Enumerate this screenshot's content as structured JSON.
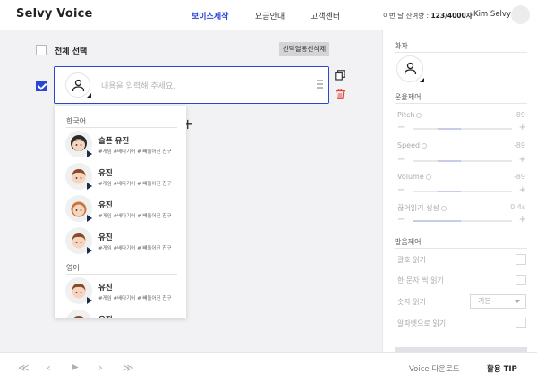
{
  "header": {
    "logo": "Selvy Voice",
    "nav": [
      "보이스제작",
      "요금안내",
      "고객센터"
    ],
    "usage_prefix": "이번 달 잔여량 : ",
    "usage_value": "123/4000자",
    "username": "Kim Selvy"
  },
  "editor": {
    "select_all_label": "전체 선택",
    "delete_selected": "선택열동선삭제",
    "placeholder": "내용을 입력해 주세요.",
    "add_symbol": "+"
  },
  "voice_dropdown": {
    "groups": [
      {
        "label": "한국어",
        "voices": [
          {
            "name": "슬픈 유진",
            "tags": "#게임 #배다기어 # 빼돌어진 친구"
          },
          {
            "name": "유진",
            "tags": "#게임 #배다기어 # 빼돌어진 친구"
          },
          {
            "name": "유진",
            "tags": "#게임 #배다기어 # 빼돌어진 친구"
          },
          {
            "name": "유진",
            "tags": "#게임 #배다기어 # 빼돌어진 친구"
          }
        ]
      },
      {
        "label": "영어",
        "voices": [
          {
            "name": "유진",
            "tags": "#게임 #배다기어 # 빼돌어진 친구"
          },
          {
            "name": "유진",
            "tags": ""
          }
        ]
      }
    ]
  },
  "panel": {
    "speaker_label": "화자",
    "prosody_label": "운율제어",
    "params": [
      {
        "label": "Pitch",
        "value": "-89"
      },
      {
        "label": "Speed",
        "value": "-89"
      },
      {
        "label": "Volume",
        "value": "-89"
      },
      {
        "label": "끊어읽기 생성",
        "value": "0.4s"
      }
    ],
    "pronunciation_label": "발음제어",
    "options": [
      {
        "label": "괄호 읽기"
      },
      {
        "label": "한 문자 씩 읽기"
      },
      {
        "label": "숫자 읽기",
        "select": "기본"
      },
      {
        "label": "알파벳으로 읽기"
      }
    ]
  },
  "footer": {
    "buttons": [
      "≪",
      "‹",
      "▶",
      "›",
      "≫"
    ],
    "voice_download": "Voice 다운로드",
    "help_tip": "활용 TIP"
  },
  "colors": {
    "accent": "#2b46d6",
    "delete": "#e0433a"
  }
}
